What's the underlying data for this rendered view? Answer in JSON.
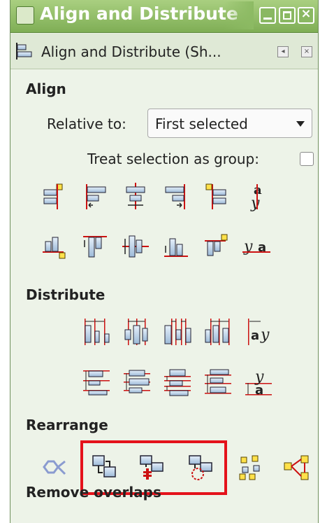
{
  "window": {
    "title": "Align and Distribute",
    "icon": "inkscape-icon"
  },
  "panel": {
    "title": "Align and Distribute (Sh...",
    "icon": "align-panel-icon",
    "buttons": [
      "panel-menu-icon",
      "panel-close-icon"
    ]
  },
  "align": {
    "heading": "Align",
    "relative_label": "Relative to:",
    "relative_value": "First selected",
    "group_label": "Treat selection as group:",
    "group_checked": false,
    "row1": [
      "align-right-edge-to-left-icon",
      "align-left-edges-icon",
      "center-vertical-axis-icon",
      "align-right-edges-icon",
      "align-left-edge-to-right-icon",
      "align-baseline-text-horizontal-icon"
    ],
    "row2": [
      "align-bottom-edge-to-top-icon",
      "align-top-edges-icon",
      "center-horizontal-axis-icon",
      "align-bottom-edges-icon",
      "align-top-edge-to-bottom-icon",
      "align-baseline-text-vertical-icon"
    ]
  },
  "distribute": {
    "heading": "Distribute",
    "row1": [
      "distribute-left-edges-icon",
      "distribute-centers-horizontal-icon",
      "distribute-gaps-horizontal-icon",
      "distribute-right-edges-icon",
      "distribute-baselines-horizontal-icon"
    ],
    "row2": [
      "distribute-top-edges-icon",
      "distribute-centers-vertical-icon",
      "distribute-gaps-vertical-icon",
      "distribute-bottom-edges-icon",
      "distribute-baselines-vertical-icon"
    ]
  },
  "rearrange": {
    "heading": "Rearrange",
    "icons": [
      "graph-layout-icon",
      "exchange-positions-icon",
      "exchange-positions-z-order-icon",
      "exchange-positions-clockwise-icon",
      "randomize-centers-icon",
      "unclump-icon"
    ],
    "highlight_color": "#e4121b"
  },
  "remove_overlaps": {
    "heading": "Remove overlaps"
  },
  "colors": {
    "accent": "#7fae55",
    "guide_red": "#cc1111",
    "box_blue": "#bcd3ea",
    "box_yellow": "#ffe14a"
  }
}
